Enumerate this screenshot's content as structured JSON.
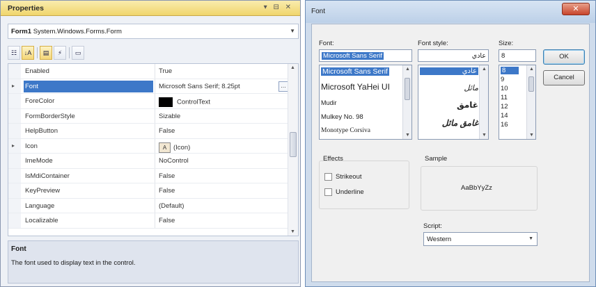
{
  "properties": {
    "title": "Properties",
    "title_controls": "▾ ⊟ ✕",
    "object_name": "Form1",
    "object_type": "System.Windows.Forms.Form",
    "toolbar": {
      "categorized": "☷",
      "alphabetical": "↓A",
      "properties": "▤",
      "events": "⚡",
      "pages": "▭"
    },
    "rows": [
      {
        "name": "Enabled",
        "value": "True"
      },
      {
        "name": "Font",
        "value": "Microsoft Sans Serif; 8.25pt"
      },
      {
        "name": "ForeColor",
        "value": "ControlText"
      },
      {
        "name": "FormBorderStyle",
        "value": "Sizable"
      },
      {
        "name": "HelpButton",
        "value": "False"
      },
      {
        "name": "Icon",
        "value": "(Icon)"
      },
      {
        "name": "ImeMode",
        "value": "NoControl"
      },
      {
        "name": "IsMdiContainer",
        "value": "False"
      },
      {
        "name": "KeyPreview",
        "value": "False"
      },
      {
        "name": "Language",
        "value": "(Default)"
      },
      {
        "name": "Localizable",
        "value": "False"
      }
    ],
    "description": {
      "heading": "Font",
      "text": "The font used to display text in the control."
    }
  },
  "font_dialog": {
    "title": "Font",
    "font_label": "Font:",
    "font_value": "Microsoft Sans Serif",
    "fonts": [
      "Microsoft Sans Serif",
      "Microsoft YaHei UI",
      "Mudir",
      "Mulkey No. 98",
      "Monotype Corsiva"
    ],
    "style_label": "Font style:",
    "style_value": "عادي",
    "styles": [
      "عادي",
      "مائل",
      "غامق",
      "غامق مائل"
    ],
    "size_label": "Size:",
    "size_value": "8",
    "sizes": [
      "8",
      "9",
      "10",
      "11",
      "12",
      "14",
      "16"
    ],
    "ok_label": "OK",
    "cancel_label": "Cancel",
    "effects_label": "Effects",
    "strikeout_label": "Strikeout",
    "underline_label": "Underline",
    "sample_label": "Sample",
    "sample_text": "AaBbYyZz",
    "script_label": "Script:",
    "script_value": "Western"
  }
}
